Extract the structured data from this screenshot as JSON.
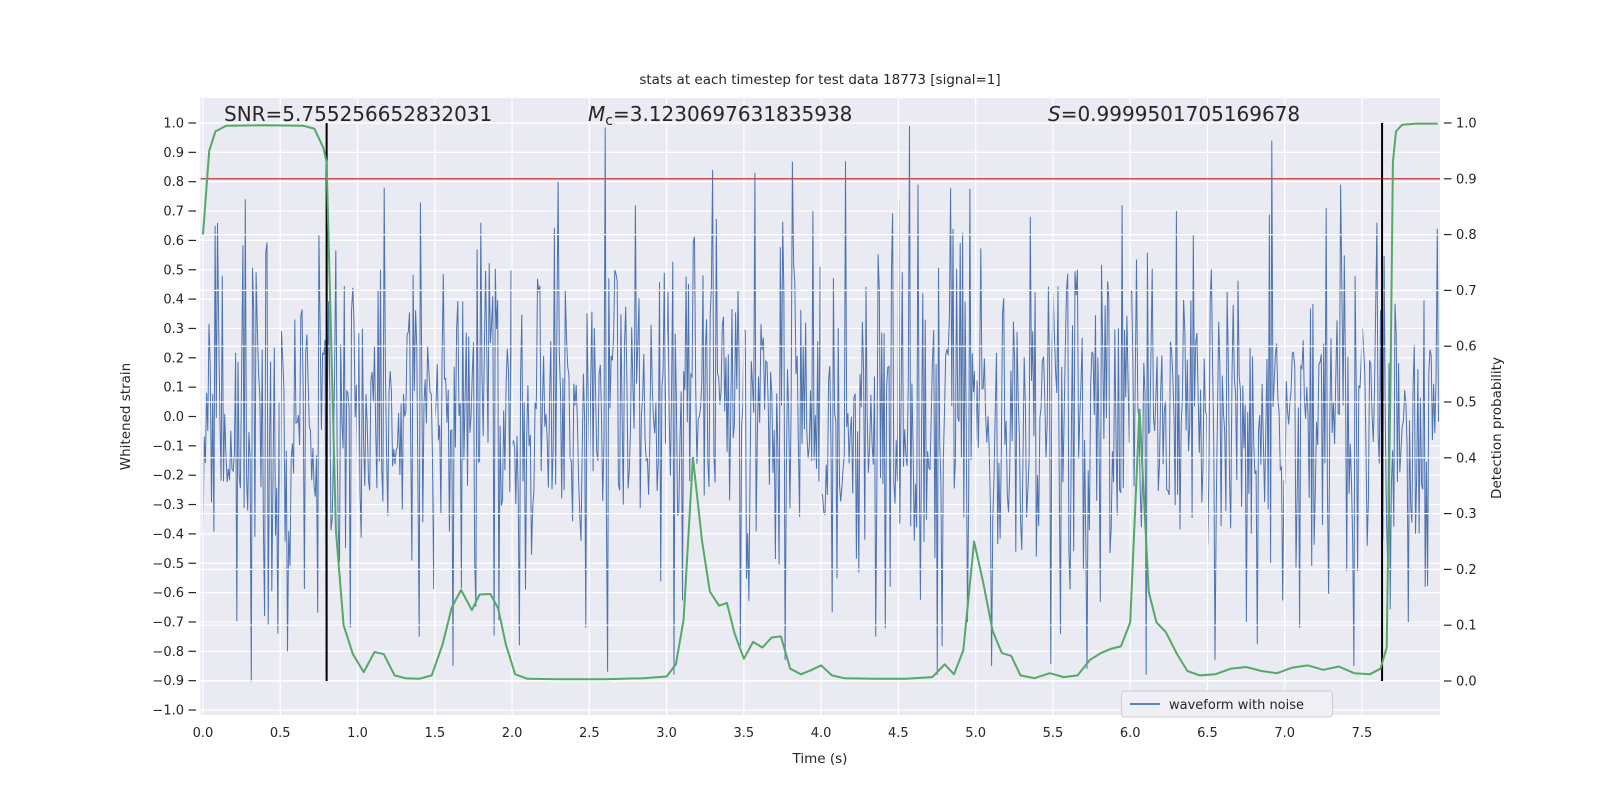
{
  "figure": {
    "background": "#ffffff",
    "plot_background": "#eaeaf2",
    "grid_color": "#ffffff",
    "text_color": "#262626"
  },
  "chart_data": {
    "type": "line",
    "title": "stats at each timestep for test data 18773 [signal=1]",
    "annotations": {
      "snr": {
        "text": "SNR=5.755256652832031"
      },
      "mc": {
        "prefix": "M",
        "sub": "c",
        "value": "=3.1230697631835938"
      },
      "s": {
        "prefix": "S",
        "value": "=0.9999501705169678"
      }
    },
    "x_axis": {
      "label": "Time (s)",
      "tick_values": [
        0,
        0.5,
        1,
        1.5,
        2,
        2.5,
        3,
        3.5,
        4,
        4.5,
        5,
        5.5,
        6,
        6.5,
        7,
        7.5
      ],
      "tick_labels": [
        "0.0",
        "0.5",
        "1.0",
        "1.5",
        "2.0",
        "2.5",
        "3.0",
        "3.5",
        "4.0",
        "4.5",
        "5.0",
        "5.5",
        "6.0",
        "6.5",
        "7.0",
        "7.5"
      ],
      "range": [
        0,
        7.995
      ]
    },
    "y_left": {
      "label": "Whitened strain",
      "tick_values": [
        1.0,
        0.9,
        0.8,
        0.7,
        0.6,
        0.5,
        0.4,
        0.3,
        0.2,
        0.1,
        0.0,
        -0.1,
        -0.2,
        -0.3,
        -0.4,
        -0.5,
        -0.6,
        -0.7,
        -0.8,
        -0.9,
        -1.0
      ],
      "tick_labels": [
        "1.0",
        "0.9",
        "0.8",
        "0.7",
        "0.6",
        "0.5",
        "0.4",
        "0.3",
        "0.2",
        "0.1",
        "0.0",
        "−0.1",
        "−0.2",
        "−0.3",
        "−0.4",
        "−0.5",
        "−0.6",
        "−0.7",
        "−0.8",
        "−0.9",
        "−1.0"
      ],
      "range": [
        -1.01,
        1.08
      ]
    },
    "y_right": {
      "label": "Detection probability",
      "tick_values": [
        0.0,
        0.1,
        0.2,
        0.3,
        0.4,
        0.5,
        0.6,
        0.7,
        0.8,
        0.9,
        1.0
      ],
      "tick_labels": [
        "0.0",
        "0.1",
        "0.2",
        "0.3",
        "0.4",
        "0.5",
        "0.6",
        "0.7",
        "0.8",
        "0.9",
        "1.0"
      ],
      "range": [
        -0.058,
        1.045
      ]
    },
    "legend": {
      "entries": [
        {
          "label": "waveform with noise",
          "color": "#4c72b0"
        }
      ]
    },
    "colors": {
      "noise": "#4c72b0",
      "probability": "#55a868",
      "threshold": "#c44e52",
      "marker": "#000000"
    },
    "series": {
      "waveform_with_noise": {
        "type": "noise_line",
        "axis": "left",
        "n_samples": 1024,
        "duration_s": 7.995,
        "sigma": 0.295,
        "clip": 0.985,
        "seed": 18773,
        "landmark_extremes": [
          [
            0.08,
            0.65
          ],
          [
            0.27,
            0.74
          ],
          [
            0.4,
            -0.68
          ],
          [
            0.55,
            -0.8
          ],
          [
            0.75,
            0.62
          ],
          [
            0.95,
            -0.72
          ],
          [
            1.17,
            0.78
          ],
          [
            1.4,
            -0.75
          ],
          [
            1.62,
            -0.85
          ],
          [
            1.8,
            0.66
          ],
          [
            2.05,
            -0.78
          ],
          [
            2.3,
            0.8
          ],
          [
            2.48,
            -0.72
          ],
          [
            2.62,
            -0.87
          ],
          [
            2.8,
            0.72
          ],
          [
            3.05,
            -0.88
          ],
          [
            3.3,
            0.84
          ],
          [
            3.48,
            -0.78
          ],
          [
            3.57,
            0.83
          ],
          [
            3.77,
            -0.83
          ],
          [
            3.95,
            0.7
          ],
          [
            4.16,
            0.87
          ],
          [
            4.35,
            -0.75
          ],
          [
            4.5,
            0.74
          ],
          [
            4.57,
            0.99
          ],
          [
            4.63,
            0.79
          ],
          [
            4.75,
            -0.88
          ],
          [
            4.95,
            -0.7
          ],
          [
            5.1,
            -0.85
          ],
          [
            5.35,
            0.68
          ],
          [
            5.55,
            -0.74
          ],
          [
            5.72,
            -0.86
          ],
          [
            5.95,
            0.72
          ],
          [
            6.1,
            -0.88
          ],
          [
            6.3,
            0.7
          ],
          [
            6.55,
            -0.83
          ],
          [
            6.75,
            -0.7
          ],
          [
            6.92,
            0.94
          ],
          [
            7.1,
            -0.72
          ],
          [
            7.27,
            0.71
          ],
          [
            7.36,
            0.79
          ],
          [
            7.45,
            -0.85
          ],
          [
            7.6,
            0.66
          ],
          [
            7.8,
            -0.7
          ]
        ]
      },
      "detection_probability": {
        "type": "line",
        "axis": "right",
        "points": [
          [
            0.0,
            0.8
          ],
          [
            0.04,
            0.95
          ],
          [
            0.08,
            0.985
          ],
          [
            0.15,
            0.995
          ],
          [
            0.4,
            0.996
          ],
          [
            0.65,
            0.995
          ],
          [
            0.72,
            0.99
          ],
          [
            0.78,
            0.955
          ],
          [
            0.8,
            0.93
          ],
          [
            0.83,
            0.6
          ],
          [
            0.86,
            0.27
          ],
          [
            0.91,
            0.1
          ],
          [
            0.97,
            0.048
          ],
          [
            1.04,
            0.016
          ],
          [
            1.11,
            0.052
          ],
          [
            1.17,
            0.048
          ],
          [
            1.24,
            0.01
          ],
          [
            1.31,
            0.005
          ],
          [
            1.4,
            0.004
          ],
          [
            1.48,
            0.01
          ],
          [
            1.55,
            0.065
          ],
          [
            1.61,
            0.132
          ],
          [
            1.67,
            0.163
          ],
          [
            1.74,
            0.127
          ],
          [
            1.79,
            0.155
          ],
          [
            1.86,
            0.156
          ],
          [
            1.91,
            0.13
          ],
          [
            1.96,
            0.065
          ],
          [
            2.02,
            0.012
          ],
          [
            2.1,
            0.004
          ],
          [
            2.3,
            0.003
          ],
          [
            2.6,
            0.003
          ],
          [
            2.85,
            0.005
          ],
          [
            3.0,
            0.008
          ],
          [
            3.06,
            0.03
          ],
          [
            3.11,
            0.11
          ],
          [
            3.17,
            0.4
          ],
          [
            3.23,
            0.25
          ],
          [
            3.28,
            0.16
          ],
          [
            3.34,
            0.135
          ],
          [
            3.39,
            0.14
          ],
          [
            3.44,
            0.085
          ],
          [
            3.5,
            0.04
          ],
          [
            3.56,
            0.07
          ],
          [
            3.62,
            0.06
          ],
          [
            3.68,
            0.078
          ],
          [
            3.74,
            0.08
          ],
          [
            3.8,
            0.022
          ],
          [
            3.87,
            0.012
          ],
          [
            3.94,
            0.02
          ],
          [
            4.0,
            0.028
          ],
          [
            4.07,
            0.01
          ],
          [
            4.15,
            0.005
          ],
          [
            4.35,
            0.004
          ],
          [
            4.55,
            0.004
          ],
          [
            4.72,
            0.007
          ],
          [
            4.8,
            0.03
          ],
          [
            4.86,
            0.012
          ],
          [
            4.92,
            0.055
          ],
          [
            4.99,
            0.25
          ],
          [
            5.05,
            0.175
          ],
          [
            5.11,
            0.09
          ],
          [
            5.17,
            0.05
          ],
          [
            5.23,
            0.045
          ],
          [
            5.29,
            0.01
          ],
          [
            5.38,
            0.005
          ],
          [
            5.48,
            0.014
          ],
          [
            5.57,
            0.007
          ],
          [
            5.66,
            0.01
          ],
          [
            5.74,
            0.038
          ],
          [
            5.81,
            0.05
          ],
          [
            5.88,
            0.058
          ],
          [
            5.94,
            0.062
          ],
          [
            6.0,
            0.105
          ],
          [
            6.06,
            0.486
          ],
          [
            6.12,
            0.16
          ],
          [
            6.17,
            0.105
          ],
          [
            6.23,
            0.088
          ],
          [
            6.3,
            0.05
          ],
          [
            6.37,
            0.018
          ],
          [
            6.45,
            0.01
          ],
          [
            6.55,
            0.012
          ],
          [
            6.65,
            0.022
          ],
          [
            6.75,
            0.025
          ],
          [
            6.85,
            0.018
          ],
          [
            6.95,
            0.014
          ],
          [
            7.05,
            0.024
          ],
          [
            7.15,
            0.028
          ],
          [
            7.25,
            0.02
          ],
          [
            7.35,
            0.026
          ],
          [
            7.45,
            0.014
          ],
          [
            7.55,
            0.012
          ],
          [
            7.62,
            0.022
          ],
          [
            7.66,
            0.06
          ],
          [
            7.685,
            0.55
          ],
          [
            7.7,
            0.93
          ],
          [
            7.72,
            0.985
          ],
          [
            7.76,
            0.997
          ],
          [
            7.85,
            0.999
          ],
          [
            7.99,
            0.999
          ]
        ]
      },
      "threshold": {
        "type": "hline",
        "axis": "right",
        "value": 0.9
      },
      "event_markers": {
        "type": "vline",
        "times": [
          0.8,
          7.63
        ],
        "span_right": [
          0.0,
          1.0
        ]
      }
    }
  }
}
